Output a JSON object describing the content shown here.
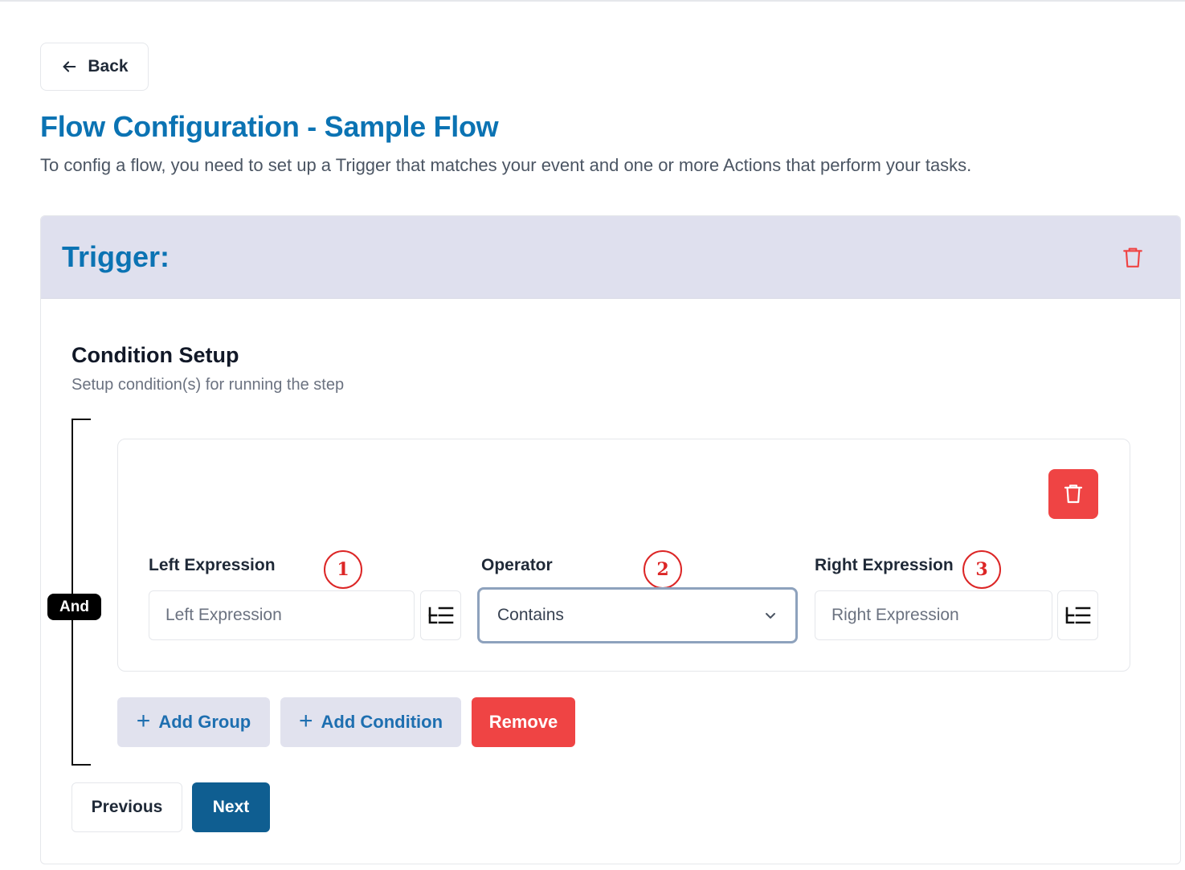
{
  "nav": {
    "back_label": "Back",
    "back_icon": "arrow-left-icon"
  },
  "page": {
    "title": "Flow Configuration - Sample Flow",
    "subtitle": "To config a flow, you need to set up a Trigger that matches your event and one or more Actions that perform your tasks."
  },
  "trigger": {
    "title": "Trigger:",
    "delete_icon": "trash-icon",
    "condition_setup": {
      "title": "Condition Setup",
      "subtitle": "Setup condition(s) for running the step",
      "logic_operator": "And",
      "group": {
        "delete_icon": "trash-icon",
        "left_expression": {
          "label": "Left Expression",
          "placeholder": "Left Expression",
          "value": "",
          "picker_icon": "expression-picker-icon"
        },
        "operator": {
          "label": "Operator",
          "value": "Contains"
        },
        "right_expression": {
          "label": "Right Expression",
          "placeholder": "Right Expression",
          "value": "",
          "picker_icon": "expression-picker-icon"
        },
        "callouts": [
          "1",
          "2",
          "3"
        ]
      },
      "actions": {
        "add_group": "Add Group",
        "add_condition": "Add Condition",
        "remove": "Remove"
      }
    },
    "footer": {
      "previous": "Previous",
      "next": "Next"
    }
  },
  "colors": {
    "accent": "#0b73b3",
    "danger": "#ef4444",
    "primary_button": "#0f5e91",
    "header_bg": "#dfe0ee",
    "callout": "#dc2626"
  }
}
